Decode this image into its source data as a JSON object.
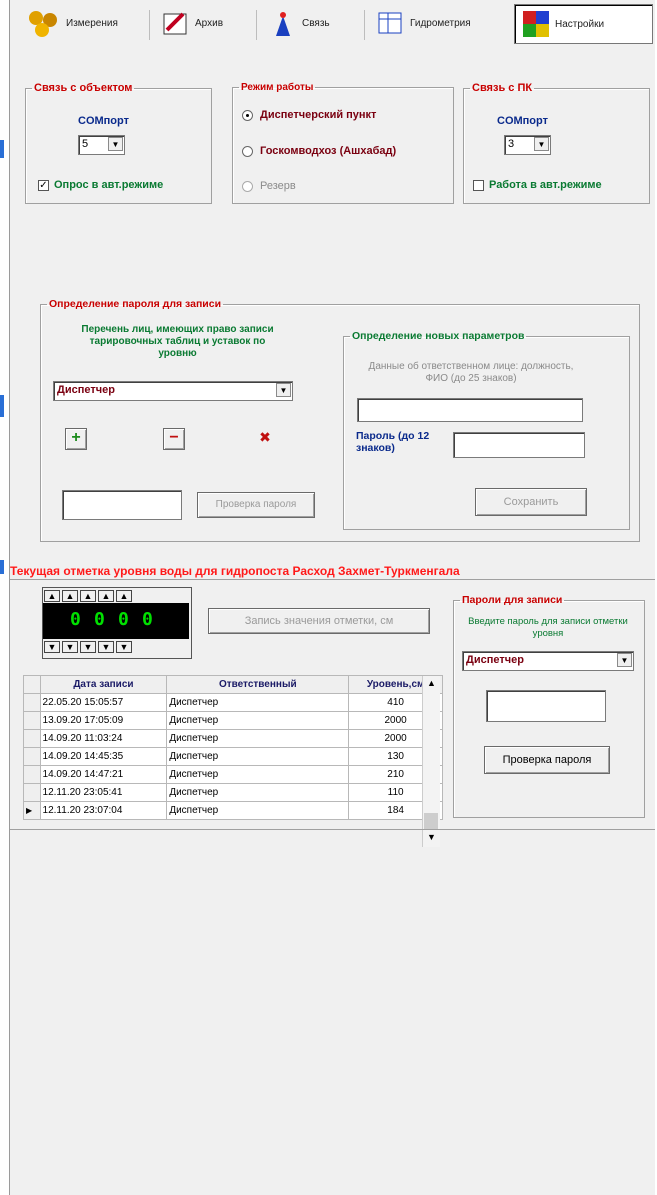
{
  "tabs": [
    {
      "label": "Измерения",
      "icon": "measure-icon"
    },
    {
      "label": "Архив",
      "icon": "archive-icon"
    },
    {
      "label": "Связь",
      "icon": "antenna-icon"
    },
    {
      "label": "Гидрометрия",
      "icon": "hydrometry-icon"
    },
    {
      "label": "Настройки",
      "icon": "settings-icon"
    }
  ],
  "object_link": {
    "title": "Связь с объектом",
    "com_label": "COMпорт",
    "com_value": "5",
    "auto_poll_label": "Опрос в авт.режиме",
    "auto_poll_checked": true
  },
  "mode": {
    "title": "Режим работы",
    "options": [
      "Диспетчерский пункт",
      "Госкомводхоз (Ашхабад)",
      "Резерв"
    ],
    "selected": 0
  },
  "pc_link": {
    "title": "Связь с ПК",
    "com_label": "COMпорт",
    "com_value": "3",
    "auto_label": "Работа в авт.режиме",
    "auto_checked": false
  },
  "password_def": {
    "title": "Определение пароля для записи",
    "list_caption": "Перечень лиц, имеющих право записи тарировочных таблиц и уставок по уровню",
    "person": "Диспетчер",
    "check_button": "Проверка пароля"
  },
  "new_params": {
    "title": "Определение новых параметров",
    "person_caption": "Данные об ответственном лице: должность, ФИО (до 25 знаков)",
    "password_caption": "Пароль (до 12 знаков)",
    "save_button": "Сохранить"
  },
  "water_level": {
    "title": "Текущая отметка уровня воды для гидропоста Расход Захмет-Туркменгала",
    "digits": [
      "0",
      "0",
      "0",
      "0"
    ],
    "write_button": "Запись значения отметки, см"
  },
  "table": {
    "headers": [
      "Дата записи",
      "Ответственный",
      "Уровень,см"
    ],
    "rows": [
      [
        "22.05.20 15:05:57",
        "Диспетчер",
        "410"
      ],
      [
        "13.09.20 17:05:09",
        "Диспетчер",
        "2000"
      ],
      [
        "14.09.20 11:03:24",
        "Диспетчер",
        "2000"
      ],
      [
        "14.09.20 14:45:35",
        "Диспетчер",
        "130"
      ],
      [
        "14.09.20 14:47:21",
        "Диспетчер",
        "210"
      ],
      [
        "12.11.20 23:05:41",
        "Диспетчер",
        "110"
      ],
      [
        "12.11.20 23:07:04",
        "Диспетчер",
        "184"
      ]
    ],
    "current_row": 6
  },
  "passwords_for_write": {
    "title": "Пароли для записи",
    "caption": "Введите пароль для записи отметки уровня",
    "person": "Диспетчер",
    "check_button": "Проверка пароля"
  },
  "colors": {
    "accent_red": "#c80000",
    "navy": "#0a2a8c",
    "green": "#0a7a32",
    "digit_green": "#00e000"
  }
}
